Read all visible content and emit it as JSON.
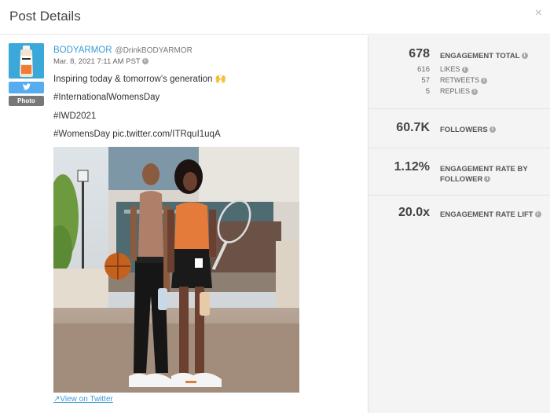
{
  "header": {
    "title": "Post Details",
    "close_icon": "×"
  },
  "post": {
    "platform_icon": "twitter-bird",
    "media_type_label": "Photo",
    "author_name": "BODYARMOR",
    "author_handle": "@DrinkBODYARMOR",
    "date": "Mar. 8, 2021 7:11 AM PST",
    "lines": [
      "Inspiring today & tomorrow’s generation 🙌",
      "#InternationalWomensDay",
      "#IWD2021",
      "#WomensDay pic.twitter.com/ITRquI1uqA"
    ],
    "view_link": "View on Twitter"
  },
  "stats": {
    "engagement_total": {
      "value": "678",
      "label": "ENGAGEMENT TOTAL"
    },
    "likes": {
      "value": "616",
      "label": "LIKES"
    },
    "retweets": {
      "value": "57",
      "label": "RETWEETS"
    },
    "replies": {
      "value": "5",
      "label": "REPLIES"
    },
    "followers": {
      "value": "60.7K",
      "label": "FOLLOWERS"
    },
    "engagement_rate": {
      "value": "1.12%",
      "label_line1": "ENGAGEMENT RATE BY",
      "label_line2": "FOLLOWER"
    },
    "engagement_lift": {
      "value": "20.0x",
      "label": "ENGAGEMENT RATE LIFT"
    }
  },
  "colors": {
    "link": "#3a9bd5",
    "twitter": "#55acee",
    "panel": "#f4f4f4"
  }
}
